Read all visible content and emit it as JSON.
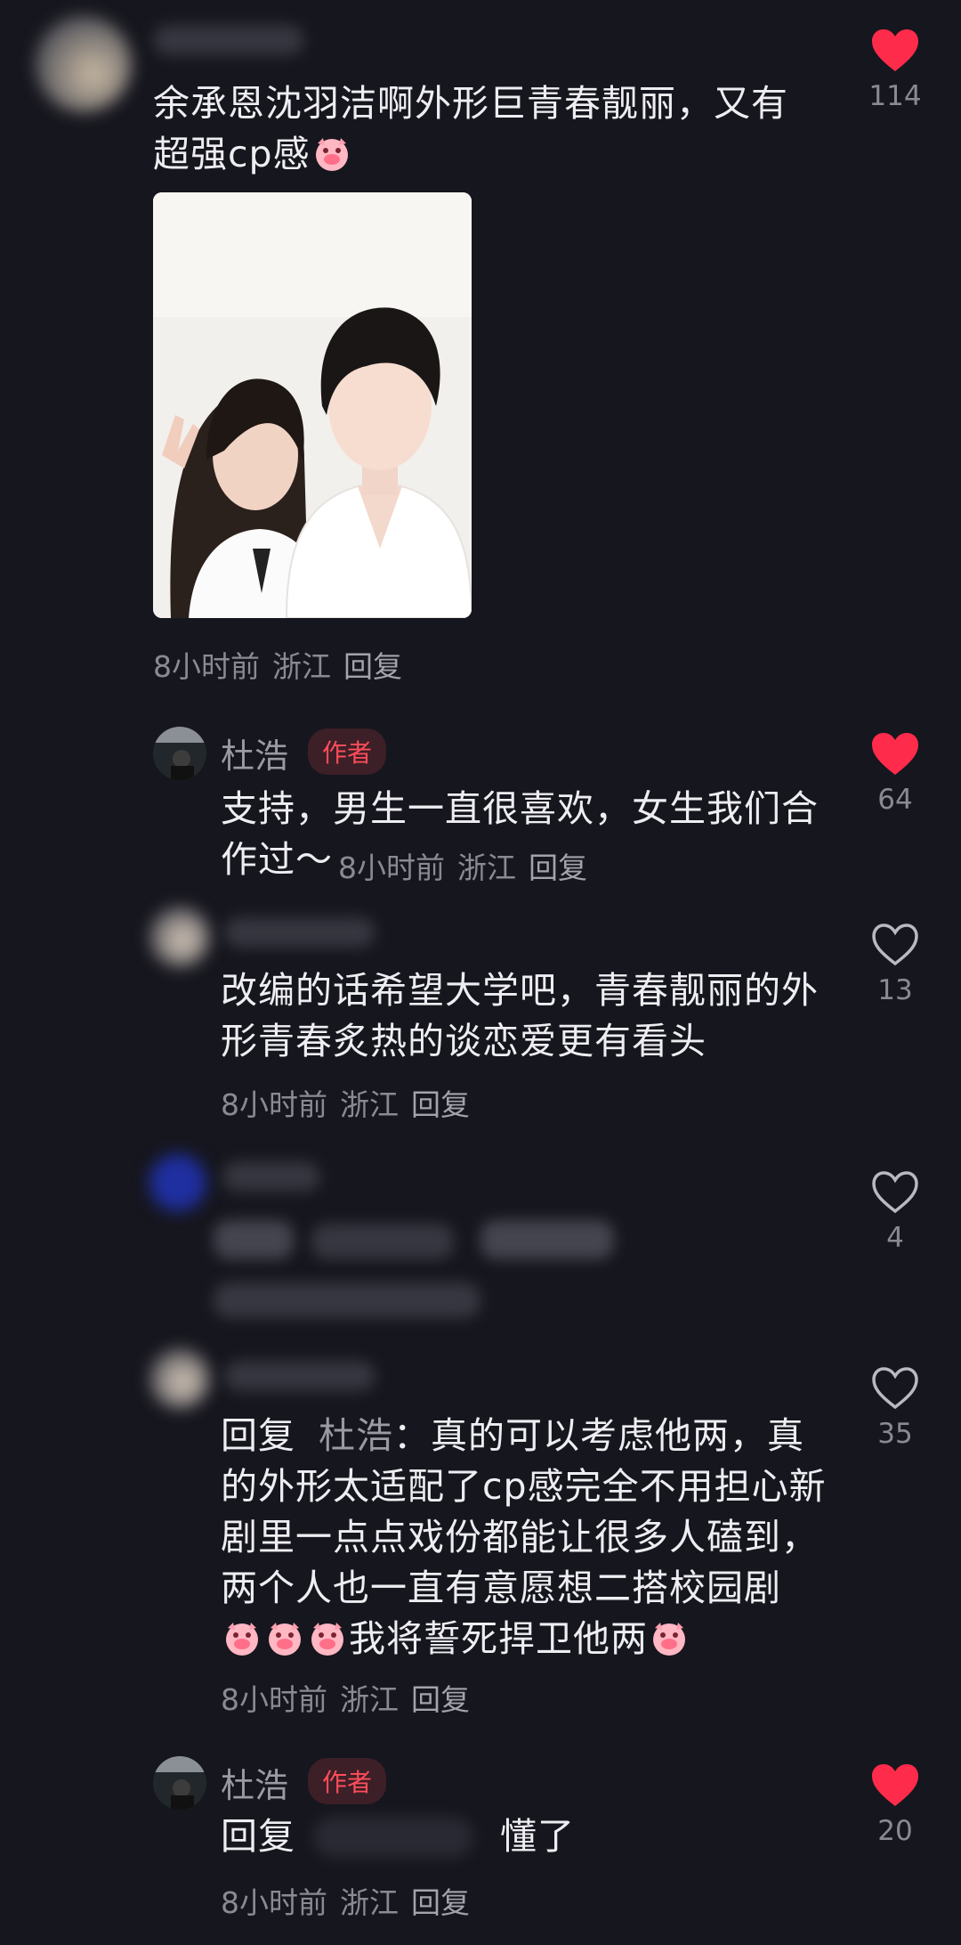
{
  "comments": [
    {
      "text_lines": [
        "余承恩沈羽洁啊外形巨青春靓丽，又有",
        "超强cp感"
      ],
      "time": "8小时前",
      "location": "浙江",
      "reply_label": "回复",
      "likes": "114",
      "liked": true,
      "has_image": true
    },
    {
      "user": "杜浩",
      "badge": "作者",
      "text_lines": [
        "支持，男生一直很喜欢，女生我们合",
        "作过～"
      ],
      "time": "8小时前",
      "location": "浙江",
      "reply_label": "回复",
      "likes": "64",
      "liked": true
    },
    {
      "text_lines": [
        "改编的话希望大学吧，青春靓丽的外",
        "形青春炙热的谈恋爱更有看头"
      ],
      "time": "8小时前",
      "location": "浙江",
      "reply_label": "回复",
      "likes": "13",
      "liked": false
    },
    {
      "likes": "4",
      "liked": false
    },
    {
      "reply_prefix": "回复",
      "reply_to": "杜浩",
      "text_lines": [
        "：真的可以考虑他两，真",
        "的外形太适配了cp感完全不用担心新",
        "剧里一点点戏份都能让很多人磕到，",
        "两个人也一直有意愿想二搭校园剧",
        "我将誓死捍卫他两"
      ],
      "time": "8小时前",
      "location": "浙江",
      "reply_label": "回复",
      "likes": "35",
      "liked": false
    },
    {
      "user": "杜浩",
      "badge": "作者",
      "reply_prefix": "回复",
      "text_tail": "懂了",
      "time": "8小时前",
      "location": "浙江",
      "reply_label": "回复",
      "likes": "20",
      "liked": true
    }
  ],
  "colors": {
    "background": "#16161e",
    "like_red": "#ff2b4a",
    "badge_red": "#ff4d5a"
  },
  "icons": {
    "like": "heart-icon",
    "emoji": "crying-pig-emoji-icon"
  }
}
